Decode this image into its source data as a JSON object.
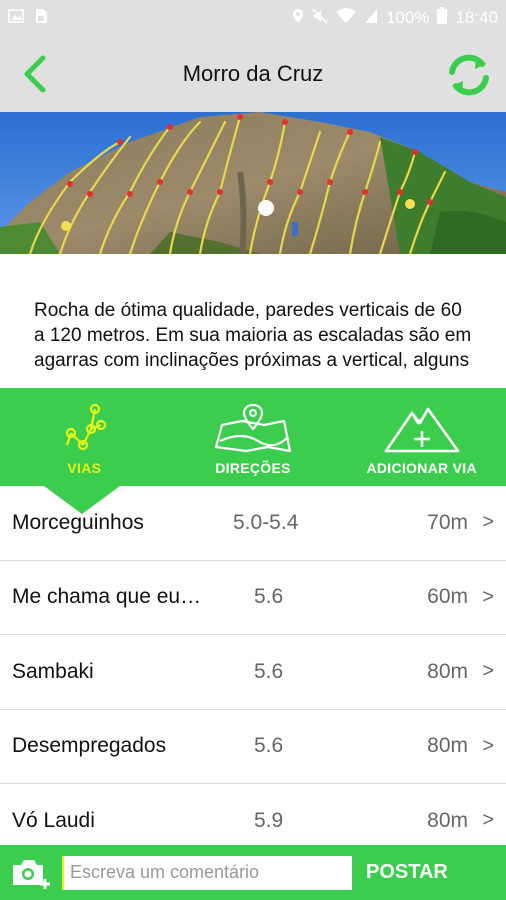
{
  "status_bar": {
    "battery": "100%",
    "time": "18:40",
    "icons": [
      "image-icon",
      "sim-icon",
      "location-icon",
      "mute-icon",
      "wifi-icon",
      "signal-icon",
      "battery-icon"
    ]
  },
  "header": {
    "title": "Morro da Cruz",
    "back_icon": "chevron-left-icon",
    "refresh_icon": "refresh-icon"
  },
  "hero": {
    "image": "crag-topo-photo"
  },
  "description": {
    "text": "Rocha de ótima qualidade, paredes verticais de 60 a 120 metros. Em sua maioria as escaladas são em agarras com inclinações próximas a vertical, alguns"
  },
  "tabs": [
    {
      "label": "VIAS",
      "icon": "routes-network-icon",
      "active": true
    },
    {
      "label": "DIREÇÕES",
      "icon": "map-pin-icon",
      "active": false
    },
    {
      "label": "ADICIONAR VIA",
      "icon": "mountain-plus-icon",
      "active": false
    }
  ],
  "routes": [
    {
      "name": "Morceguinhos",
      "grade": "5.0-5.4",
      "length": "70m",
      "chevron": ">"
    },
    {
      "name": "Me chama que eu…",
      "grade": "5.6",
      "length": "60m",
      "chevron": ">"
    },
    {
      "name": "Sambaki",
      "grade": "5.6",
      "length": "80m",
      "chevron": ">"
    },
    {
      "name": "Desempregados",
      "grade": "5.6",
      "length": "80m",
      "chevron": ">"
    },
    {
      "name": "Vó Laudi",
      "grade": "5.9",
      "length": "80m",
      "chevron": ">"
    }
  ],
  "comment_bar": {
    "placeholder": "Escreva um comentário",
    "post_label": "POSTAR",
    "camera_icon": "camera-add-icon"
  },
  "colors": {
    "accent": "#3dcd4e",
    "active_tab": "#e6f21b",
    "app_bar": "#e0e0e0"
  }
}
